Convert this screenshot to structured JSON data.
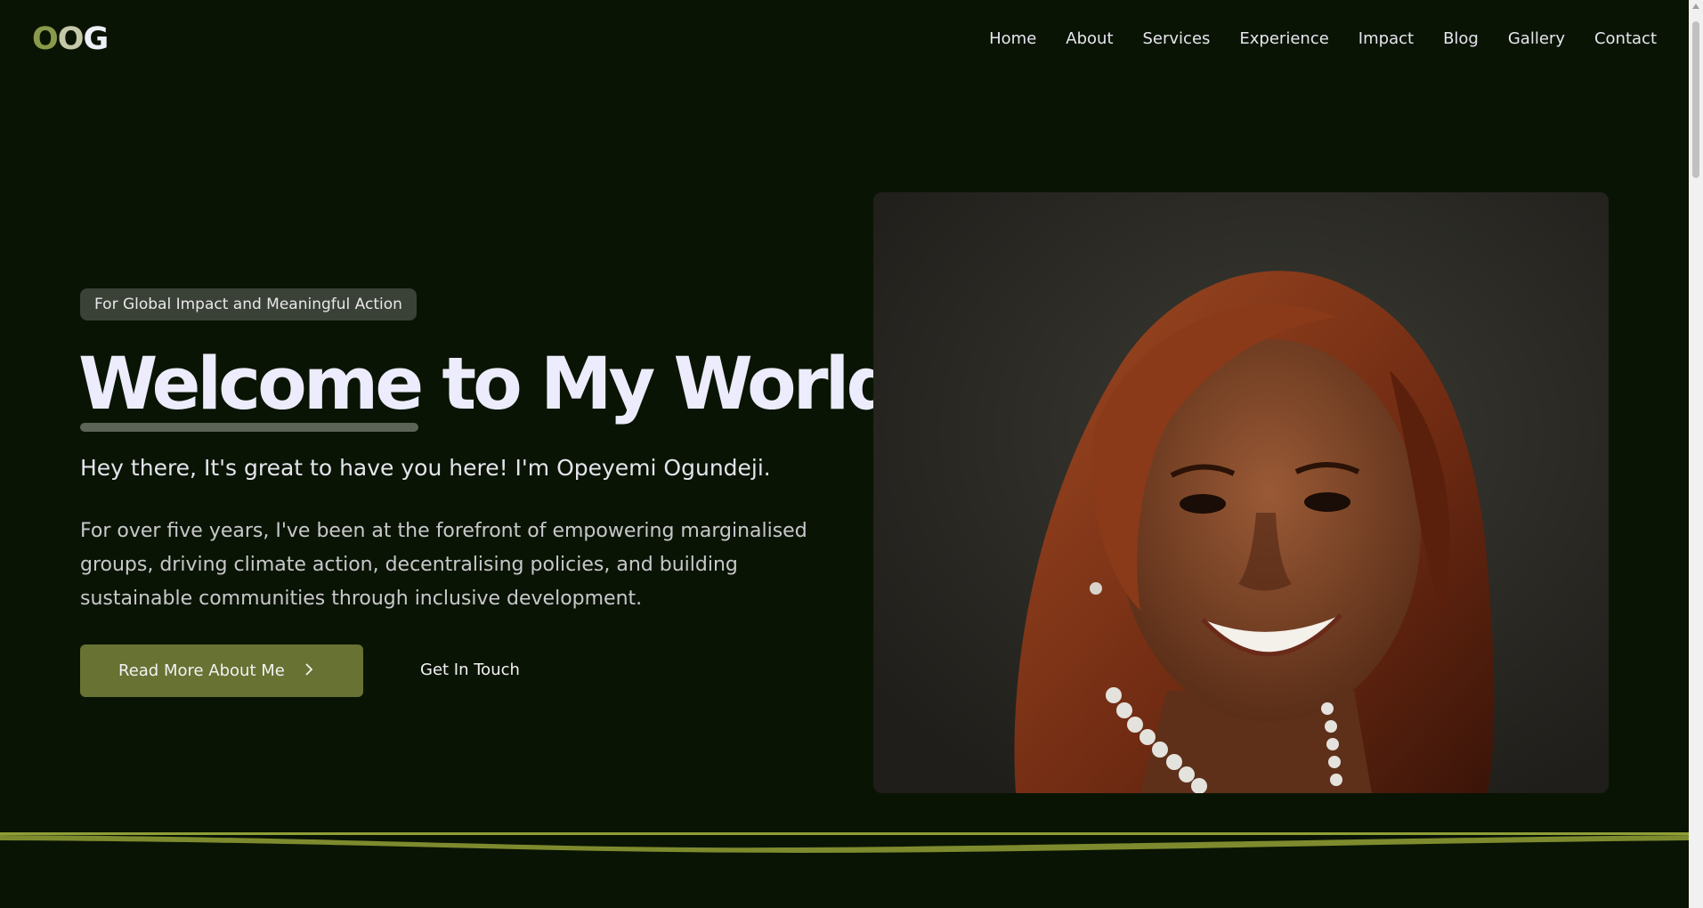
{
  "header": {
    "logo": [
      "O",
      "O",
      "G"
    ],
    "nav": [
      "Home",
      "About",
      "Services",
      "Experience",
      "Impact",
      "Blog",
      "Gallery",
      "Contact"
    ]
  },
  "hero": {
    "tag": "For Global Impact and Meaningful Action",
    "headline_word1": "Welcome",
    "headline_rest": " to My World",
    "greeting": "Hey there, It's great to have you here! I'm Opeyemi Ogundeji.",
    "bio": "For over five years, I've been at the forefront of empowering marginalised groups, driving climate action, decentralising policies, and building sustainable communities through inclusive development.",
    "primary_button": "Read More About Me",
    "secondary_button": "Get In Touch"
  },
  "colors": {
    "background": "#0a1404",
    "accent": "#677233",
    "logo_o1": "#8a9a4a",
    "logo_o2": "#c4c8a8",
    "wave": "#7d8b2e"
  },
  "icons": {
    "button_arrow": "chevron-right-icon",
    "portrait": "portrait-photo"
  }
}
